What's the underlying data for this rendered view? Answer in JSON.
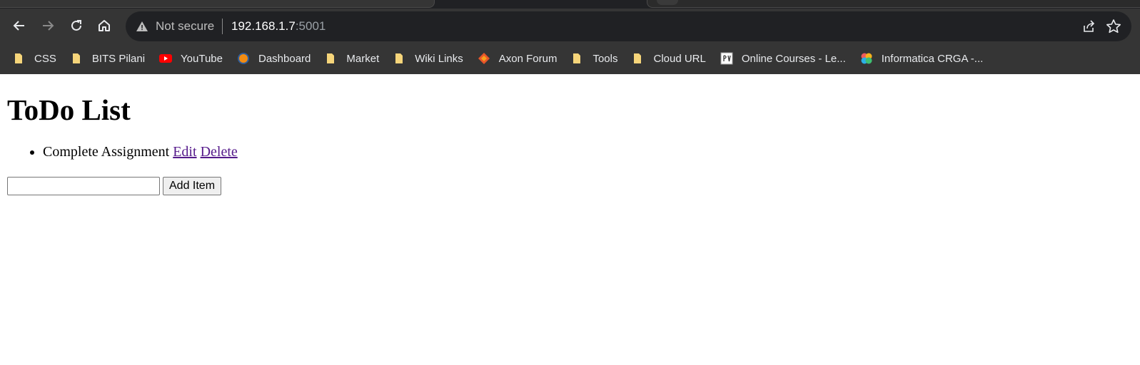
{
  "browser": {
    "security_label": "Not secure",
    "url_host": "192.168.1.7",
    "url_port": ":5001",
    "icons": [
      "back-icon",
      "forward-icon",
      "reload-icon",
      "home-icon",
      "warning-icon",
      "share-icon",
      "star-icon"
    ],
    "bookmarks": [
      {
        "label": "CSS",
        "icon": "folder-icon"
      },
      {
        "label": "BITS Pilani",
        "icon": "folder-icon"
      },
      {
        "label": "YouTube",
        "icon": "youtube-icon"
      },
      {
        "label": "Dashboard",
        "icon": "dashboard-icon"
      },
      {
        "label": "Market",
        "icon": "folder-icon"
      },
      {
        "label": "Wiki Links",
        "icon": "folder-icon"
      },
      {
        "label": "Axon Forum",
        "icon": "axon-icon"
      },
      {
        "label": "Tools",
        "icon": "folder-icon"
      },
      {
        "label": "Cloud URL",
        "icon": "folder-icon"
      },
      {
        "label": "Online Courses - Le...",
        "icon": "courses-icon"
      },
      {
        "label": "Informatica CRGA -...",
        "icon": "informatica-icon"
      }
    ]
  },
  "page": {
    "title": "ToDo List",
    "items": [
      {
        "text": "Complete Assignment",
        "edit_label": "Edit",
        "delete_label": "Delete"
      }
    ],
    "new_item_value": "",
    "add_button_label": "Add Item"
  },
  "colors": {
    "chrome_bg": "#353535",
    "omnibox_bg": "#202124",
    "link_visited": "#551a8b",
    "folder": "#f6d57a"
  }
}
